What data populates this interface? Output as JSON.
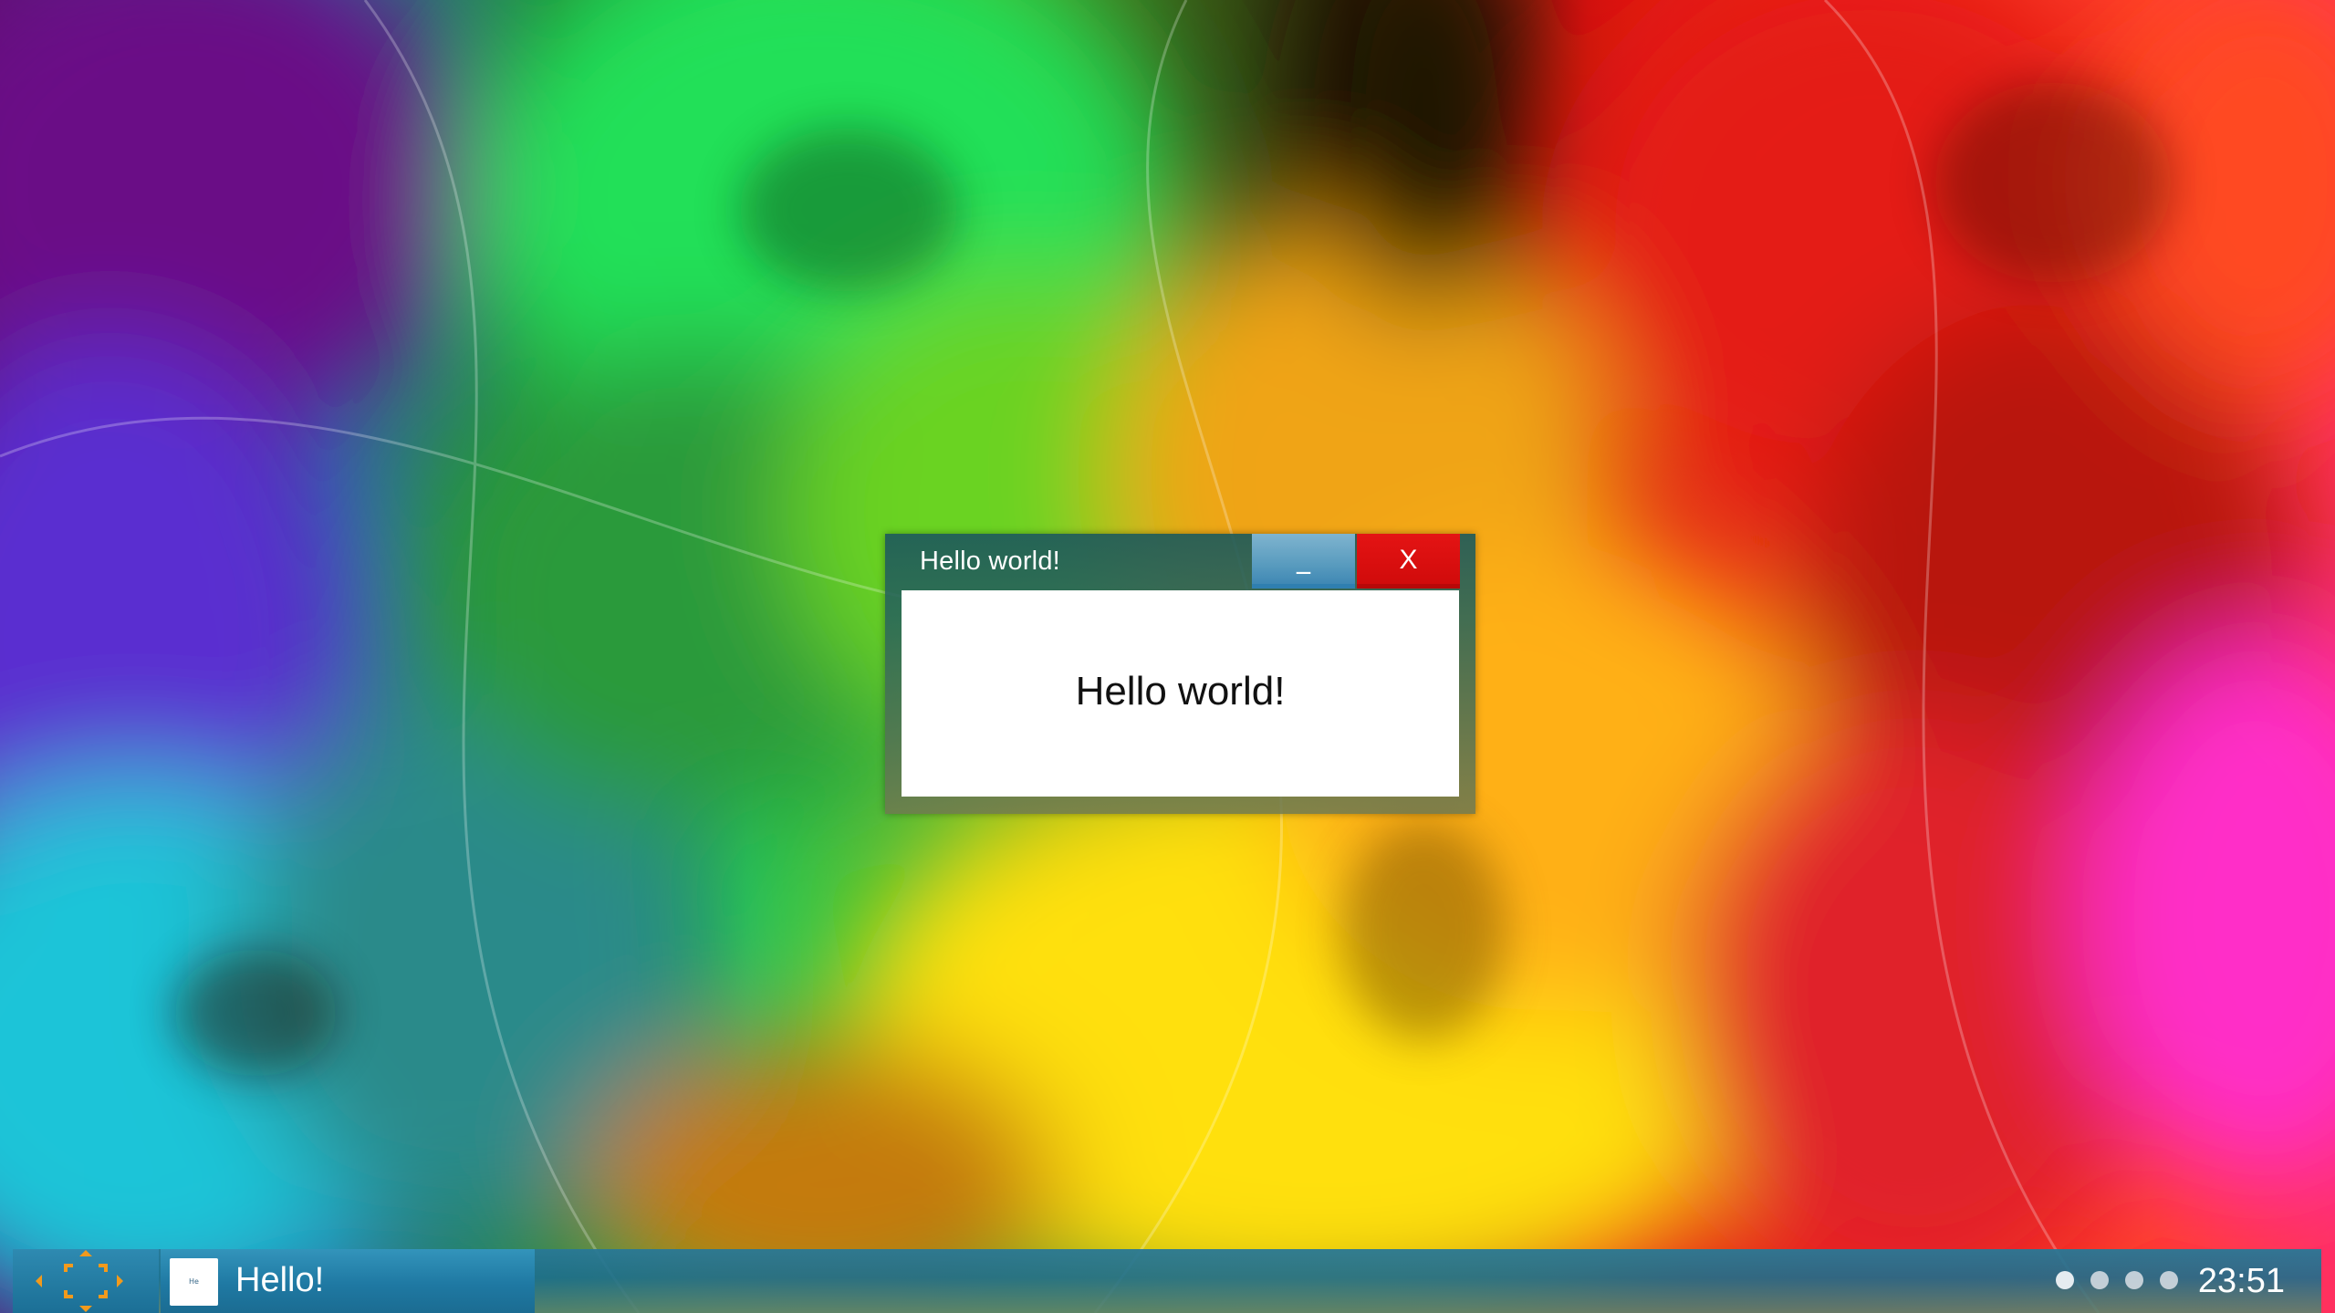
{
  "window": {
    "title": "Hello world!",
    "minimize_label": "_",
    "close_label": "X",
    "message": "Hello world!"
  },
  "taskbar": {
    "task_label": "Hello!",
    "task_thumb_text": "He",
    "clock": "23:51",
    "start_icon": "move-arrows-icon",
    "workspace_count": 4,
    "active_workspace": 1
  },
  "colors": {
    "close": "#e01010",
    "minimize": "#5fa1c4",
    "taskbar": "#1f7aa3",
    "start_arrows": "#f29a1c"
  }
}
